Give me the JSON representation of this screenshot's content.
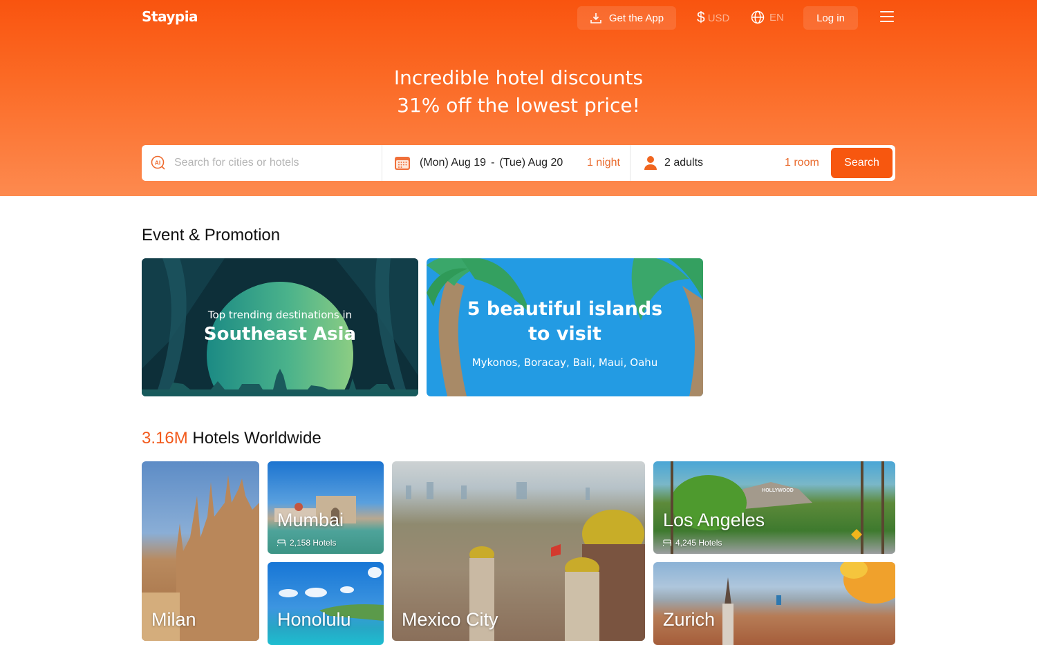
{
  "header": {
    "logo": "Staypia",
    "get_app": "Get the App",
    "currency_symbol": "$",
    "currency": "USD",
    "language": "EN",
    "login": "Log in"
  },
  "hero": {
    "line1": "Incredible hotel discounts",
    "line2": "31% off the lowest price!"
  },
  "search": {
    "placeholder": "Search for cities or hotels",
    "checkin": "(Mon) Aug 19",
    "date_separator": "-",
    "checkout": "(Tue) Aug 20",
    "nights": "1 night",
    "adults": "2 adults",
    "rooms": "1 room",
    "button": "Search"
  },
  "promotions": {
    "title": "Event & Promotion",
    "items": [
      {
        "subtitle": "Top trending destinations in",
        "title": "Southeast Asia"
      },
      {
        "title_line1": "5 beautiful islands",
        "title_line2": "to visit",
        "subtitle": "Mykonos, Boracay, Bali, Maui, Oahu"
      }
    ]
  },
  "hotels": {
    "count": "3.16M",
    "title": "Hotels Worldwide",
    "cities": [
      {
        "name": "Milan"
      },
      {
        "name": "Mumbai",
        "hotels": "2,158 Hotels"
      },
      {
        "name": "Honolulu"
      },
      {
        "name": "Mexico City"
      },
      {
        "name": "Los Angeles",
        "hotels": "4,245 Hotels"
      },
      {
        "name": "Zurich"
      }
    ]
  },
  "colors": {
    "brand": "#f7570f",
    "accent_text": "#e96a2c"
  }
}
